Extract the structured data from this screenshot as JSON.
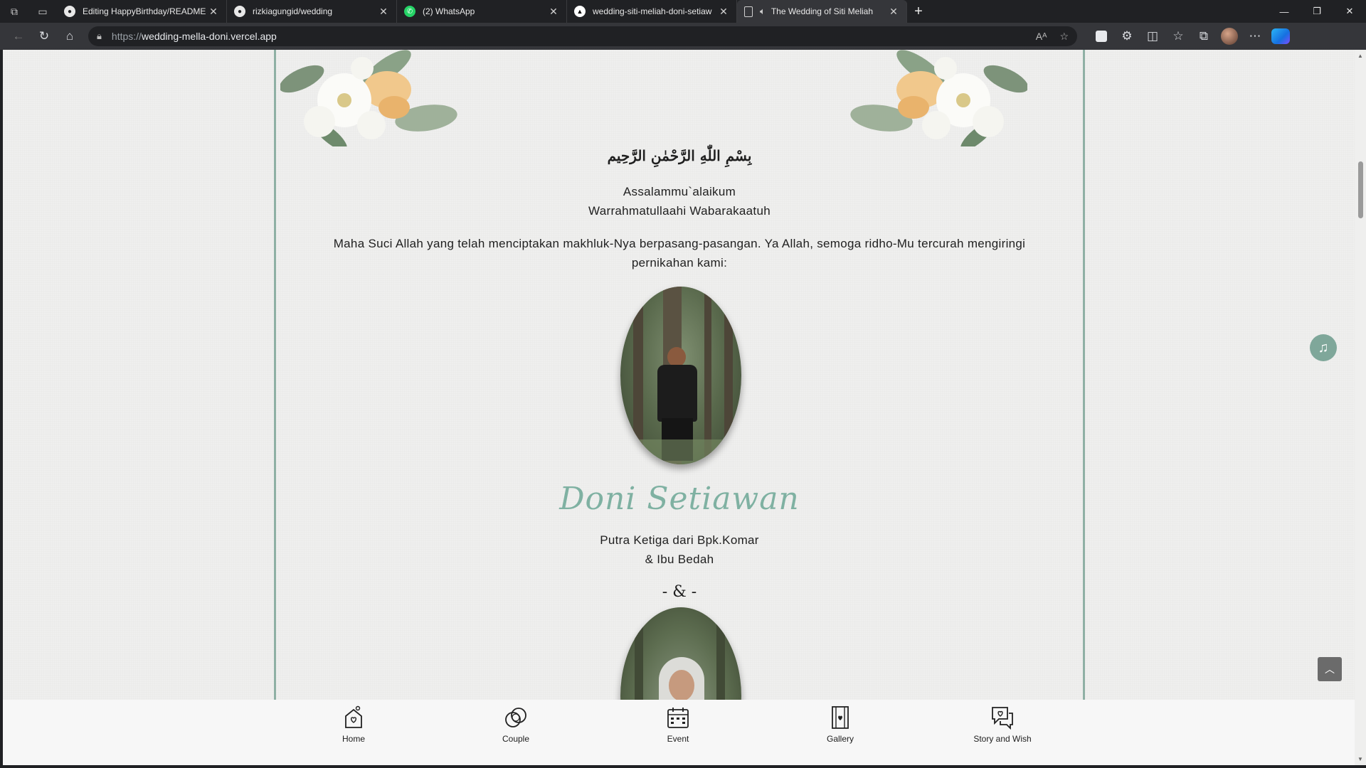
{
  "browser": {
    "tabs": [
      {
        "title": "Editing HappyBirthday/README",
        "icon": "github-icon",
        "active": false
      },
      {
        "title": "rizkiagungid/wedding",
        "icon": "github-icon",
        "active": false
      },
      {
        "title": "(2) WhatsApp",
        "icon": "whatsapp-icon",
        "active": false
      },
      {
        "title": "wedding-siti-meliah-doni-setiaw",
        "icon": "vercel-icon",
        "active": false
      },
      {
        "title": "The Wedding of Siti Meliah",
        "icon": "page-icon",
        "active": true
      }
    ],
    "url_scheme": "https://",
    "url_host": "wedding-mella-doni.vercel.app"
  },
  "page": {
    "bismillah": "بِسْمِ اللّٰهِ الرَّحْمٰنِ الرَّحِيم",
    "greeting_line1": "Assalammu`alaikum",
    "greeting_line2": "Warrahmatullaahi Wabarakaatuh",
    "verse": "Maha Suci Allah yang telah menciptakan makhluk-Nya berpasang-pasangan. Ya Allah, semoga ridho-Mu tercurah mengiringi pernikahan kami:",
    "groom": {
      "name": "Doni Setiawan",
      "parents_line1": "Putra Ketiga dari Bpk.Komar",
      "parents_line2": "& Ibu Bedah"
    },
    "separator": "- & -"
  },
  "bottom_nav": [
    {
      "label": "Home",
      "icon": "house-heart-icon"
    },
    {
      "label": "Couple",
      "icon": "rings-icon"
    },
    {
      "label": "Event",
      "icon": "calendar-icon"
    },
    {
      "label": "Gallery",
      "icon": "film-gallery-icon"
    },
    {
      "label": "Story and Wish",
      "icon": "chat-heart-icon"
    }
  ],
  "colors": {
    "accent": "#7fb1a2",
    "frame_border": "#8fb0a4",
    "page_bg": "#efefee"
  }
}
